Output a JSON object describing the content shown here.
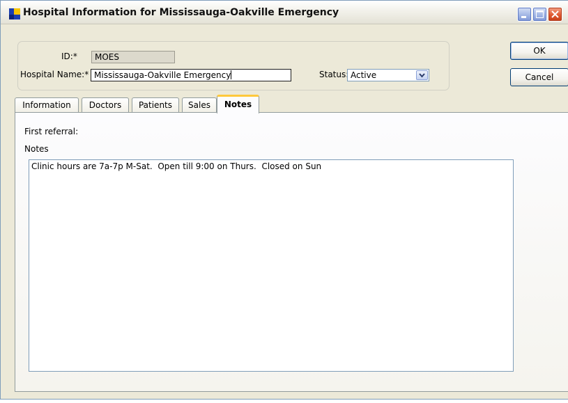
{
  "window": {
    "title": "Hospital Information for Mississauga-Oakville Emergency",
    "icon": "app-flag-icon",
    "colors": {
      "titlebar_bg": "#ece9d8",
      "tab_accent": "#ffc83c",
      "close_button": "#e05a33"
    }
  },
  "header": {
    "id_label": "ID:*",
    "id_value": "MOES",
    "hospital_name_label": "Hospital Name:*",
    "hospital_name_value": "Mississauga-Oakville Emergency",
    "status_label": "Status:",
    "status_value": "Active"
  },
  "buttons": {
    "ok": "OK",
    "cancel": "Cancel"
  },
  "tabs": [
    {
      "label": "Information",
      "active": false
    },
    {
      "label": "Doctors",
      "active": false
    },
    {
      "label": "Patients",
      "active": false
    },
    {
      "label": "Sales",
      "active": false
    },
    {
      "label": "Notes",
      "active": true
    }
  ],
  "notes_tab": {
    "first_referral_label": "First referral:",
    "notes_label": "Notes",
    "notes_text": "Clinic hours are 7a-7p M-Sat.  Open till 9:00 on Thurs.  Closed on Sun"
  }
}
